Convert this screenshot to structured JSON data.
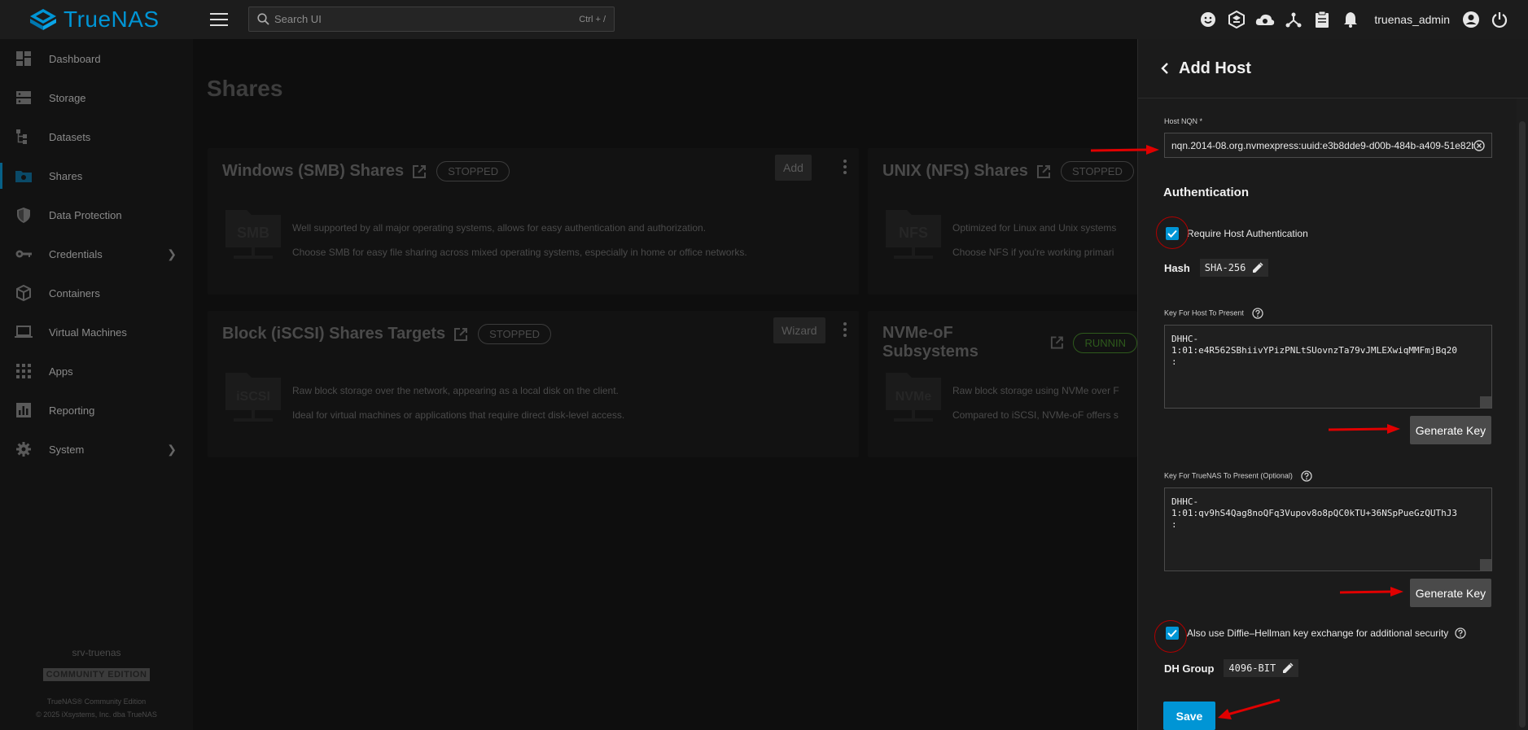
{
  "brand": {
    "name": "TrueNAS",
    "accent": "#0095d5"
  },
  "search": {
    "placeholder": "Search UI",
    "shortcut": "Ctrl + /"
  },
  "topbar": {
    "icons": [
      "smiley-icon",
      "truecommand-icon",
      "cloud-icon",
      "network-icon",
      "clipboard-icon",
      "bell-icon"
    ],
    "username": "truenas_admin"
  },
  "sidebar": {
    "items": [
      {
        "label": "Dashboard",
        "icon": "dashboard-icon"
      },
      {
        "label": "Storage",
        "icon": "storage-icon"
      },
      {
        "label": "Datasets",
        "icon": "datasets-icon"
      },
      {
        "label": "Shares",
        "icon": "shares-icon"
      },
      {
        "label": "Data Protection",
        "icon": "shield-icon"
      },
      {
        "label": "Credentials",
        "icon": "key-icon"
      },
      {
        "label": "Containers",
        "icon": "cube-icon"
      },
      {
        "label": "Virtual Machines",
        "icon": "laptop-icon"
      },
      {
        "label": "Apps",
        "icon": "apps-grid-icon"
      },
      {
        "label": "Reporting",
        "icon": "chart-icon"
      },
      {
        "label": "System",
        "icon": "gear-icon"
      }
    ],
    "hostname": "srv-truenas",
    "edition": "COMMUNITY EDITION",
    "copyright1": "TrueNAS® Community Edition",
    "copyright2": "© 2025 iXsystems, Inc. dba TrueNAS"
  },
  "main": {
    "title": "Shares",
    "cards": [
      {
        "title": "Windows (SMB) Shares",
        "status": "STOPPED",
        "button": "Add",
        "icon_text": "SMB",
        "line1": "Well supported by all major operating systems, allows for easy authentication and authorization.",
        "line2": "Choose SMB for easy file sharing across mixed operating systems, especially in home or office networks."
      },
      {
        "title": "UNIX (NFS) Shares",
        "status": "STOPPED",
        "button": "",
        "icon_text": "NFS",
        "line1": "Optimized for Linux and Unix systems",
        "line2": "Choose NFS if you're working primari"
      },
      {
        "title": "Block (iSCSI) Shares Targets",
        "status": "STOPPED",
        "button": "Wizard",
        "icon_text": "iSCSI",
        "line1": "Raw block storage over the network, appearing as a local disk on the client.",
        "line2": "Ideal for virtual machines or applications that require direct disk-level access."
      },
      {
        "title": "NVMe-oF Subsystems",
        "status": "RUNNIN",
        "button": "",
        "icon_text": "NVMe",
        "line1": "Raw block storage using NVMe over F",
        "line2": "Compared to iSCSI, NVMe-oF offers s"
      }
    ]
  },
  "panel": {
    "title": "Add Host",
    "host_nqn": {
      "label": "Host NQN *",
      "value": "nqn.2014-08.org.nvmexpress:uuid:e3b8dde9-d00b-484b-a409-51e82b"
    },
    "auth_title": "Authentication",
    "require_auth": {
      "label": "Require Host Authentication",
      "checked": true
    },
    "hash": {
      "label": "Hash",
      "value": "SHA-256"
    },
    "host_key": {
      "label": "Key For Host To Present",
      "value": "DHHC-\n1:01:e4R562SBhiivYPizPNLtSUovnzTa79vJMLEXwiqMMFmjBq20\n:"
    },
    "generate_label": "Generate Key",
    "truenas_key": {
      "label": "Key For TrueNAS To Present (Optional)",
      "value": "DHHC-\n1:01:qv9hS4Qag8noQFq3Vupov8o8pQC0kTU+36NSpPueGzQUThJ3\n:"
    },
    "dh": {
      "label": "Also use Diffie–Hellman key exchange for additional security",
      "checked": true
    },
    "dh_group": {
      "label": "DH Group",
      "value": "4096-BIT"
    },
    "save_label": "Save"
  },
  "colors": {
    "annotation_red": "#e00000",
    "panel_bg": "#1b1b1b",
    "checkbox": "#0095d5"
  }
}
